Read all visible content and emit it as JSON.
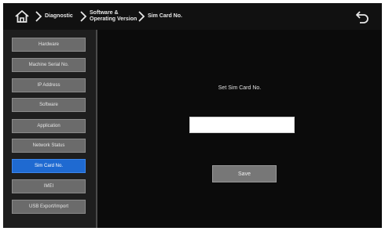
{
  "breadcrumb": {
    "item1": "Diagnostic",
    "item2_line1": "Software &",
    "item2_line2": "Operating Version",
    "item3": "Sim Card No."
  },
  "sidebar": {
    "items": [
      {
        "label": "Hardware",
        "active": false
      },
      {
        "label": "Machine Serial No.",
        "active": false
      },
      {
        "label": "IP Address",
        "active": false
      },
      {
        "label": "Software",
        "active": false
      },
      {
        "label": "Application",
        "active": false
      },
      {
        "label": "Network Status",
        "active": false
      },
      {
        "label": "Sim Card No.",
        "active": true
      },
      {
        "label": "IMEI",
        "active": false
      },
      {
        "label": "USB Export/Import",
        "active": false
      }
    ]
  },
  "main": {
    "heading": "Set Sim Card No.",
    "input_value": "",
    "save_label": "Save"
  },
  "colors": {
    "active_item": "#1f6ad1",
    "button_gray": "#6b6b6b",
    "background": "#0b0b0b"
  },
  "icons": {
    "home": "home-icon",
    "breadcrumb_separator": "chevron-right-icon",
    "back": "back-arrow-icon"
  }
}
